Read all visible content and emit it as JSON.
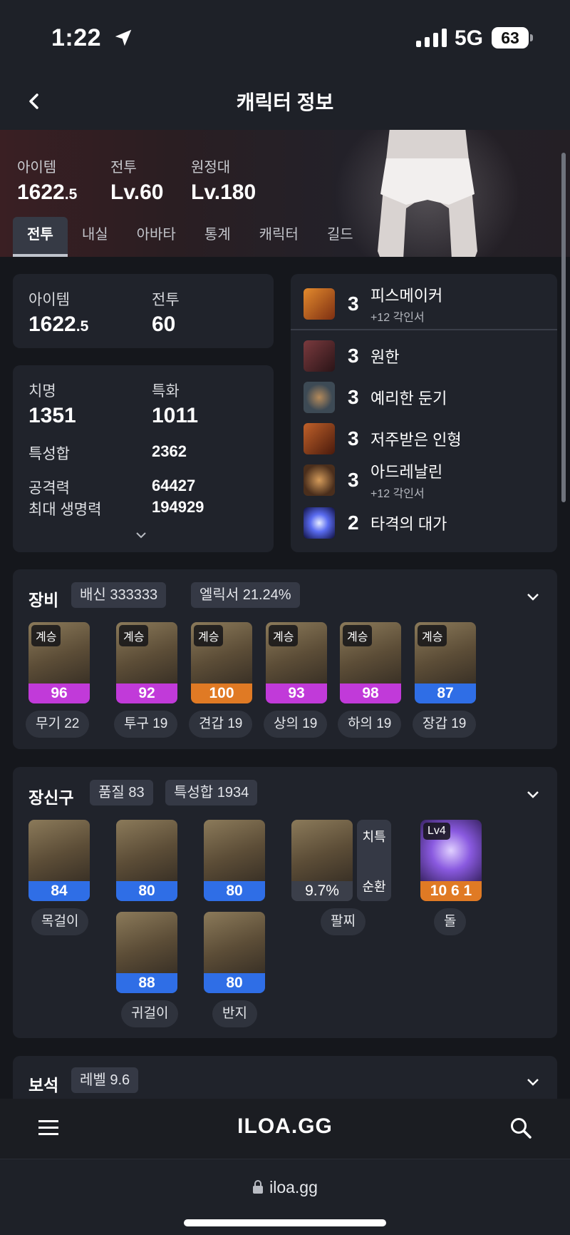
{
  "status": {
    "time": "1:22",
    "network": "5G",
    "battery": "63"
  },
  "nav": {
    "title": "캐릭터 정보"
  },
  "hero": {
    "stats": [
      {
        "label": "아이템",
        "value": "1622",
        "decimal": ".5"
      },
      {
        "label": "전투",
        "value": "Lv.60",
        "decimal": ""
      },
      {
        "label": "원정대",
        "value": "Lv.180",
        "decimal": ""
      }
    ]
  },
  "tabs": [
    "전투",
    "내실",
    "아바타",
    "통계",
    "캐릭터",
    "길드"
  ],
  "summary": {
    "item_label": "아이템",
    "item_value": "1622",
    "item_decimal": ".5",
    "battle_label": "전투",
    "battle_value": "60"
  },
  "stats": {
    "crit_label": "치명",
    "crit_value": "1351",
    "spec_label": "특화",
    "spec_value": "1011",
    "total_label": "특성합",
    "total_value": "2362",
    "atk_label": "공격력",
    "atk_value": "64427",
    "hp_label": "최대 생명력",
    "hp_value": "194929"
  },
  "engravings": [
    {
      "level": "3",
      "name": "피스메이커",
      "sub": "+12 각인서",
      "icon": "peacemaker-icon",
      "color": "#c3561f"
    },
    {
      "level": "3",
      "name": "원한",
      "sub": "",
      "icon": "grudge-icon",
      "color": "#5a2a2e"
    },
    {
      "level": "3",
      "name": "예리한 둔기",
      "sub": "",
      "icon": "keen-blunt-weapon-icon",
      "color": "#3d4a55"
    },
    {
      "level": "3",
      "name": "저주받은 인형",
      "sub": "",
      "icon": "cursed-doll-icon",
      "color": "#8a3a1c"
    },
    {
      "level": "3",
      "name": "아드레날린",
      "sub": "+12 각인서",
      "icon": "adrenaline-icon",
      "color": "#6b4a30"
    },
    {
      "level": "2",
      "name": "타격의 대가",
      "sub": "",
      "icon": "hit-master-icon",
      "color": "#3b4fd1"
    }
  ],
  "equipment": {
    "title": "장비",
    "chips": [
      "배신 333333",
      "엘릭서 21.24%"
    ],
    "items": [
      {
        "tag": "계승",
        "quality": "96",
        "tier": "purple",
        "label": "무기 22"
      },
      {
        "tag": "계승",
        "quality": "92",
        "tier": "purple",
        "label": "투구 19"
      },
      {
        "tag": "계승",
        "quality": "100",
        "tier": "orange",
        "label": "견갑 19"
      },
      {
        "tag": "계승",
        "quality": "93",
        "tier": "purple",
        "label": "상의 19"
      },
      {
        "tag": "계승",
        "quality": "98",
        "tier": "purple",
        "label": "하의 19"
      },
      {
        "tag": "계승",
        "quality": "87",
        "tier": "blue",
        "label": "장갑 19"
      }
    ]
  },
  "accessories": {
    "title": "장신구",
    "chips": [
      "품질 83",
      "특성합 1934"
    ],
    "necklace": {
      "quality": "84",
      "label": "목걸이"
    },
    "earrings": [
      {
        "quality": "80"
      },
      {
        "quality": "88"
      }
    ],
    "earring_label": "귀걸이",
    "rings": [
      {
        "quality": "80"
      },
      {
        "quality": "80"
      }
    ],
    "ring_label": "반지",
    "bracelet": {
      "quality": "9.7%",
      "stat1": "치특",
      "stat2": "순환",
      "label": "팔찌"
    },
    "stone": {
      "tag": "Lv4",
      "value": "10 6 1",
      "label": "돌"
    }
  },
  "gems": {
    "title": "보석",
    "chip": "레벨 9.6"
  },
  "footer": {
    "brand": "ILOA.GG",
    "url": "iloa.gg"
  }
}
